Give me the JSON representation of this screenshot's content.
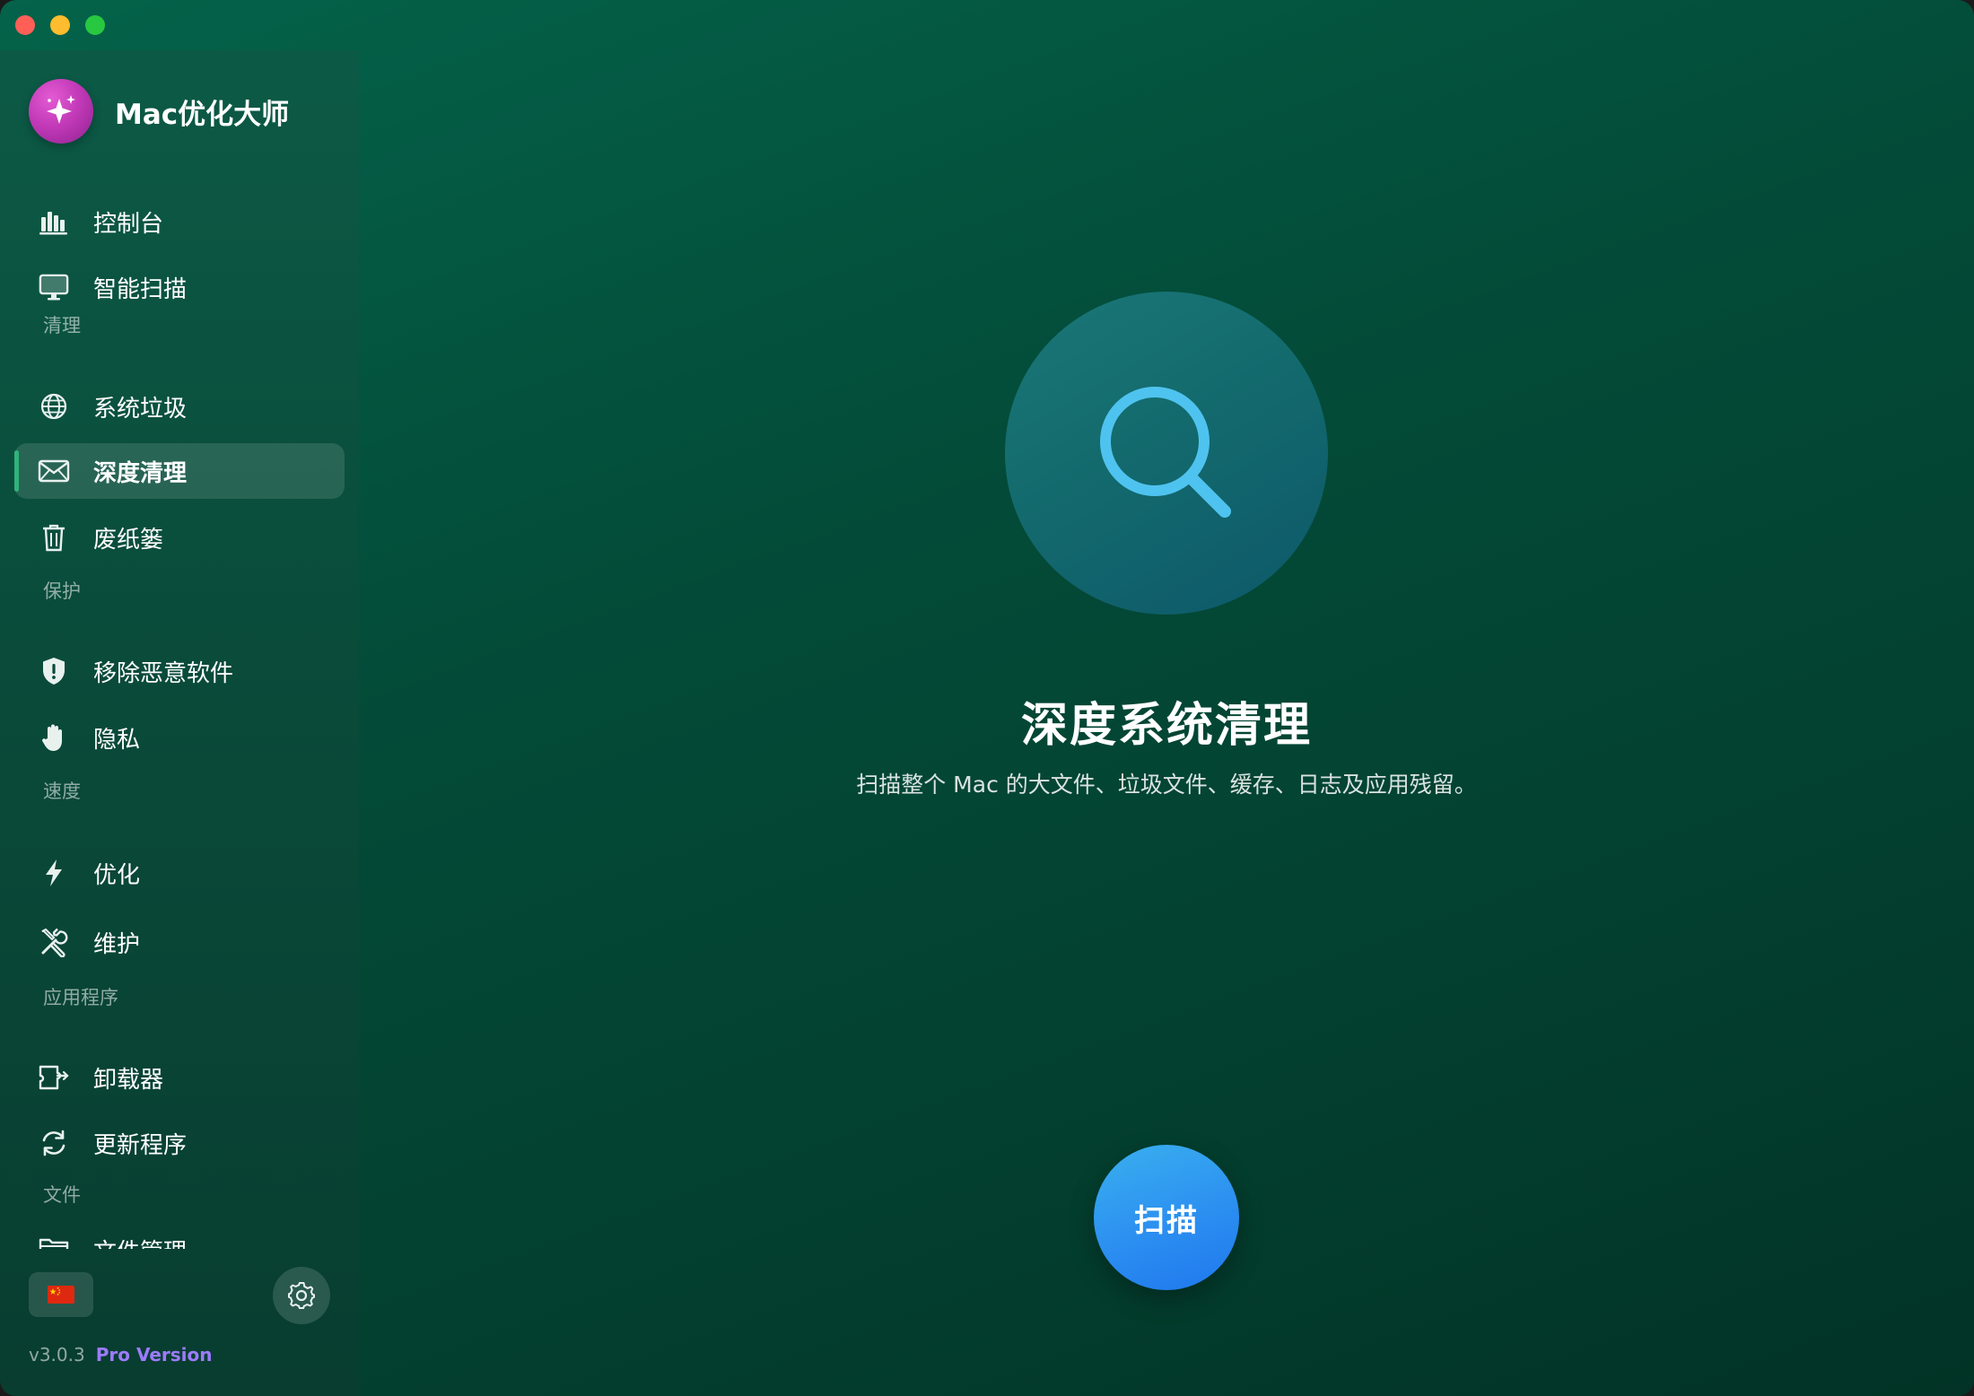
{
  "app": {
    "name": "Mac优化大师"
  },
  "sidebar": {
    "items": [
      {
        "label": "控制台"
      },
      {
        "label": "智能扫描"
      },
      {
        "label": "系统垃圾"
      },
      {
        "label": "深度清理",
        "active": true
      },
      {
        "label": "废纸篓"
      },
      {
        "label": "移除恶意软件"
      },
      {
        "label": "隐私"
      },
      {
        "label": "优化"
      },
      {
        "label": "维护"
      },
      {
        "label": "卸载器"
      },
      {
        "label": "更新程序"
      },
      {
        "label": "文件管理"
      }
    ],
    "sections": {
      "clean": "清理",
      "protect": "保护",
      "speed": "速度",
      "apps": "应用程序",
      "files": "文件"
    },
    "version": "v3.0.3",
    "pro_label": "Pro Version"
  },
  "main": {
    "title": "深度系统清理",
    "subtitle": "扫描整个 Mac 的大文件、垃圾文件、缓存、日志及应用残留。",
    "scan_button": "扫描"
  },
  "colors": {
    "accent_active": "#2fb47a",
    "scan_button": "#2a8cf0",
    "pro_text": "#9d7bff"
  }
}
